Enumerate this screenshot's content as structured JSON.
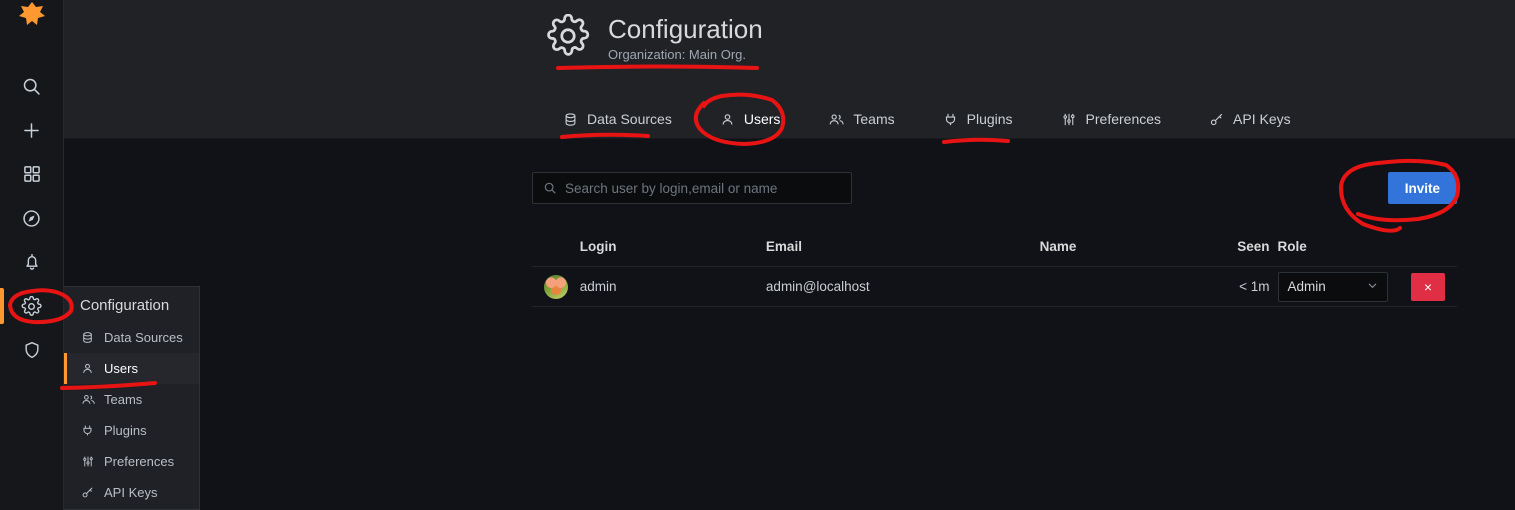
{
  "app": {
    "brand_icon": "grafana-logo-icon",
    "accent_color": "#ff9830",
    "primary_color": "#3274d9",
    "danger_color": "#e02f44",
    "annotation_color": "#e81414"
  },
  "rail": {
    "items": [
      {
        "icon": "search-icon",
        "label": "Search"
      },
      {
        "icon": "plus-icon",
        "label": "Create"
      },
      {
        "icon": "dashboards-grid-icon",
        "label": "Dashboards"
      },
      {
        "icon": "compass-explore-icon",
        "label": "Explore"
      },
      {
        "icon": "bell-alerting-icon",
        "label": "Alerting"
      },
      {
        "icon": "gear-configuration-icon",
        "label": "Configuration",
        "active": true
      },
      {
        "icon": "shield-server-admin-icon",
        "label": "Server Admin"
      }
    ]
  },
  "flyout": {
    "title": "Configuration",
    "items": [
      {
        "label": "Data Sources",
        "icon": "database-icon",
        "active": false
      },
      {
        "label": "Users",
        "icon": "user-icon",
        "active": true
      },
      {
        "label": "Teams",
        "icon": "users-alt-icon",
        "active": false
      },
      {
        "label": "Plugins",
        "icon": "plug-icon",
        "active": false
      },
      {
        "label": "Preferences",
        "icon": "sliders-icon",
        "active": false
      },
      {
        "label": "API Keys",
        "icon": "key-icon",
        "active": false
      }
    ]
  },
  "header": {
    "icon": "gear-configuration-icon",
    "title": "Configuration",
    "subtitle": "Organization: Main Org."
  },
  "tabs": [
    {
      "label": "Data Sources",
      "icon": "database-icon",
      "active": false
    },
    {
      "label": "Users",
      "icon": "user-icon",
      "active": true
    },
    {
      "label": "Teams",
      "icon": "users-alt-icon",
      "active": false
    },
    {
      "label": "Plugins",
      "icon": "plug-icon",
      "active": false
    },
    {
      "label": "Preferences",
      "icon": "sliders-icon",
      "active": false
    },
    {
      "label": "API Keys",
      "icon": "key-icon",
      "active": false
    }
  ],
  "toolbar": {
    "search_placeholder": "Search user by login,email or name",
    "search_value": "",
    "search_icon": "search-icon",
    "invite_label": "Invite"
  },
  "table": {
    "columns": [
      "Login",
      "Email",
      "Name",
      "Seen",
      "Role"
    ],
    "rows": [
      {
        "avatar": "user-avatar",
        "login": "admin",
        "email": "admin@localhost",
        "name": "",
        "seen": "< 1m",
        "role": "Admin",
        "delete_label": "×"
      }
    ]
  },
  "annotations": {
    "title_underline": "red-underline-under-page-title",
    "data_sources_underline": "red-underline-under-data-sources-tab",
    "users_circle": "red-circle-around-users-tab",
    "plugins_underline": "red-underline-under-plugins-tab",
    "invite_circle": "red-circle-around-invite-button",
    "gear_circle": "red-circle-around-configuration-gear-icon",
    "users_menu_underline": "red-underline-under-users-menu-item"
  }
}
